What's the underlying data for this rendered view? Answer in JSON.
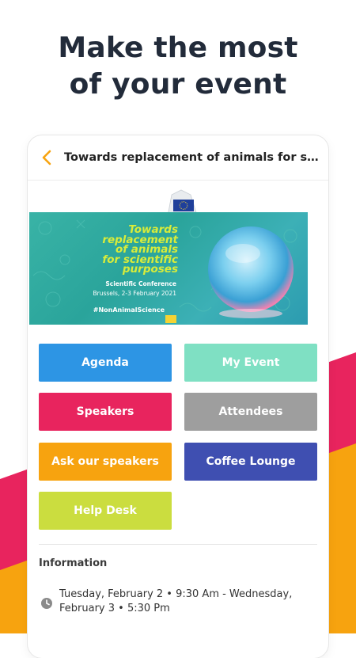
{
  "headline": {
    "line1": "Make the most",
    "line2": "of your event"
  },
  "appbar": {
    "title": "Towards replacement of animals for scientific purposes"
  },
  "banner": {
    "logo_text": "European Commission",
    "title_lines": [
      "Towards",
      "replacement",
      "of animals",
      "for scientific",
      "purposes"
    ],
    "subtitle": "Scientific Conference",
    "date": "Brussels, 2-3 February 2021",
    "hashtag": "#NonAnimalScience"
  },
  "tiles": [
    {
      "label": "Agenda",
      "color": "#2d95e4"
    },
    {
      "label": "My Event",
      "color": "#7fe0c3"
    },
    {
      "label": "Speakers",
      "color": "#e8245e"
    },
    {
      "label": "Attendees",
      "color": "#9e9e9e"
    },
    {
      "label": "Ask our speakers",
      "color": "#f7a30f"
    },
    {
      "label": "Coffee Lounge",
      "color": "#3f4fb1"
    },
    {
      "label": "Help Desk",
      "color": "#cbdd3f"
    }
  ],
  "information": {
    "label": "Information",
    "datetime": "Tuesday, February 2 • 9:30 Am - Wednesday, February 3 • 5:30 Pm"
  },
  "colors": {
    "accent": "#f7a30f",
    "pink": "#e8245e",
    "headline": "#222b3a"
  }
}
